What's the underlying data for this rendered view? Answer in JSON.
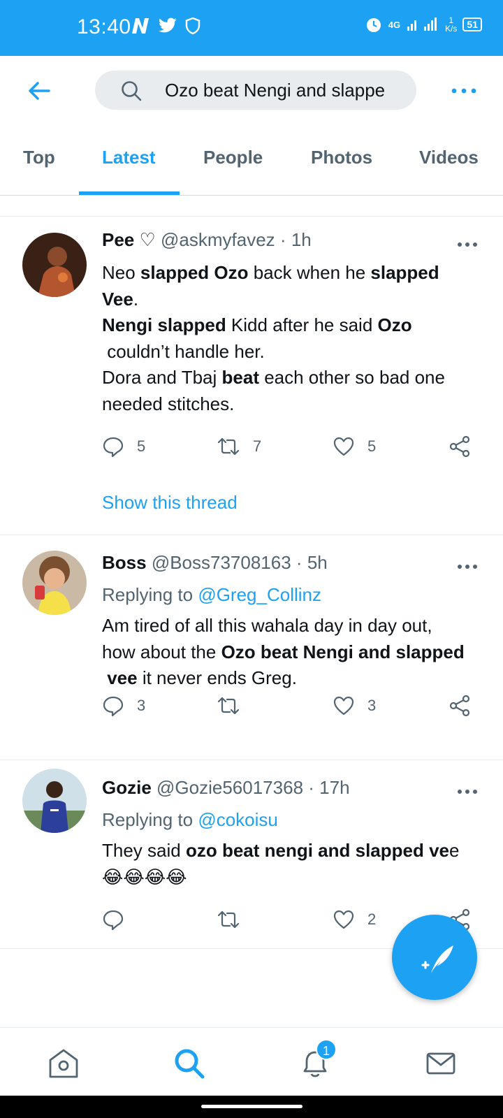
{
  "status_bar": {
    "time": "13:40",
    "network": "4G",
    "speed_value": "1",
    "speed_unit": "K/s",
    "battery": "51"
  },
  "search": {
    "query": "Ozo beat Nengi and slappe"
  },
  "tabs": [
    {
      "label": "Top"
    },
    {
      "label": "Latest"
    },
    {
      "label": "People"
    },
    {
      "label": "Photos"
    },
    {
      "label": "Videos"
    }
  ],
  "active_tab": "Latest",
  "tweets": [
    {
      "name": "Pee ♡",
      "handle": "@askmyfavez",
      "time": "1h",
      "body_lines": [
        [
          "Neo ",
          "slapped Ozo",
          " back when he ",
          "slapped"
        ],
        [
          "Vee",
          "."
        ],
        [
          "Nengi slapped",
          " Kidd after he said ",
          "Ozo"
        ],
        [
          " couldn’t handle her."
        ],
        [
          "Dora and Tbaj ",
          "beat",
          " each other so bad one"
        ],
        [
          "needed stitches."
        ]
      ],
      "replies": "5",
      "retweets": "7",
      "likes": "5",
      "show_thread": "Show this thread"
    },
    {
      "name": "Boss",
      "handle": "@Boss73708163",
      "time": "5h",
      "replying_prefix": "Replying to",
      "replying_to": "@Greg_Collinz",
      "body_lines": [
        [
          "Am tired of all this wahala day in day out,"
        ],
        [
          "how about the ",
          "Ozo beat Nengi and slapped"
        ],
        [
          " vee",
          " it never ends Greg."
        ]
      ],
      "replies": "3",
      "retweets": "",
      "likes": "3"
    },
    {
      "name": "Gozie",
      "handle": "@Gozie56017368",
      "time": "17h",
      "replying_prefix": "Replying to",
      "replying_to": "@cokoisu",
      "body_lines": [
        [
          "They said ",
          "ozo beat nengi and slapped ve",
          "e"
        ],
        [
          "😂😂😂😂"
        ]
      ],
      "replies": "",
      "retweets": "",
      "likes": "2"
    }
  ],
  "bottom_nav": {
    "notification_count": "1"
  },
  "colors": {
    "brand": "#1da1f2",
    "text": "#0f1419",
    "secondary": "#536471"
  }
}
